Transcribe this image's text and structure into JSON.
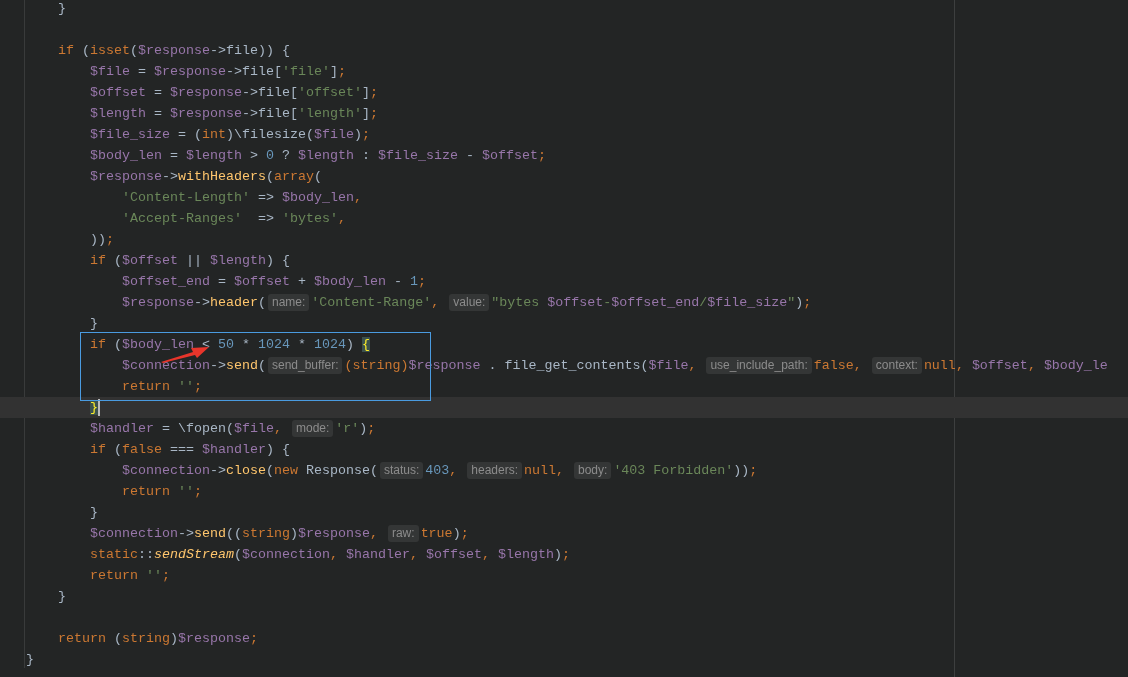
{
  "editor": {
    "lines": [
      {
        "current": false,
        "tokens": [
          {
            "text": "    }",
            "kind": "plain"
          }
        ]
      },
      {
        "current": false
      },
      {
        "current": false,
        "tokens": [
          {
            "text": "    if",
            "kind": "keyword"
          },
          {
            "text": " (",
            "kind": "plain"
          },
          {
            "text": "isset",
            "kind": "keyword"
          },
          {
            "text": "(",
            "kind": "plain"
          },
          {
            "text": "$response",
            "kind": "var"
          },
          {
            "text": "->file)) {",
            "kind": "plain"
          }
        ]
      },
      {
        "current": false,
        "tokens": [
          {
            "text": "        $file",
            "kind": "var"
          },
          {
            "text": " = ",
            "kind": "plain"
          },
          {
            "text": "$response",
            "kind": "var"
          },
          {
            "text": "->file[",
            "kind": "plain"
          },
          {
            "text": "'file'",
            "kind": "string"
          },
          {
            "text": "]",
            "kind": "plain"
          },
          {
            "text": ";",
            "kind": "keyword"
          }
        ]
      },
      {
        "current": false,
        "tokens": [
          {
            "text": "        $offset",
            "kind": "var"
          },
          {
            "text": " = ",
            "kind": "plain"
          },
          {
            "text": "$response",
            "kind": "var"
          },
          {
            "text": "->file[",
            "kind": "plain"
          },
          {
            "text": "'offset'",
            "kind": "string"
          },
          {
            "text": "]",
            "kind": "plain"
          },
          {
            "text": ";",
            "kind": "keyword"
          }
        ]
      },
      {
        "current": false,
        "tokens": [
          {
            "text": "        $length",
            "kind": "var"
          },
          {
            "text": " = ",
            "kind": "plain"
          },
          {
            "text": "$response",
            "kind": "var"
          },
          {
            "text": "->file[",
            "kind": "plain"
          },
          {
            "text": "'length'",
            "kind": "string"
          },
          {
            "text": "]",
            "kind": "plain"
          },
          {
            "text": ";",
            "kind": "keyword"
          }
        ]
      },
      {
        "current": false,
        "tokens": [
          {
            "text": "        $file_size",
            "kind": "var"
          },
          {
            "text": " = (",
            "kind": "plain"
          },
          {
            "text": "int",
            "kind": "keyword"
          },
          {
            "text": ")\\filesize(",
            "kind": "plain"
          },
          {
            "text": "$file",
            "kind": "var"
          },
          {
            "text": ")",
            "kind": "plain"
          },
          {
            "text": ";",
            "kind": "keyword"
          }
        ]
      },
      {
        "current": false,
        "tokens": [
          {
            "text": "        $body_len",
            "kind": "var"
          },
          {
            "text": " = ",
            "kind": "plain"
          },
          {
            "text": "$length",
            "kind": "var"
          },
          {
            "text": " > ",
            "kind": "plain"
          },
          {
            "text": "0",
            "kind": "number"
          },
          {
            "text": " ? ",
            "kind": "plain"
          },
          {
            "text": "$length",
            "kind": "var"
          },
          {
            "text": " : ",
            "kind": "plain"
          },
          {
            "text": "$file_size",
            "kind": "var"
          },
          {
            "text": " - ",
            "kind": "plain"
          },
          {
            "text": "$offset",
            "kind": "var"
          },
          {
            "text": ";",
            "kind": "keyword"
          }
        ]
      },
      {
        "current": false,
        "tokens": [
          {
            "text": "        $response",
            "kind": "var"
          },
          {
            "text": "->",
            "kind": "plain"
          },
          {
            "text": "withHeaders",
            "kind": "function"
          },
          {
            "text": "(",
            "kind": "plain"
          },
          {
            "text": "array",
            "kind": "keyword"
          },
          {
            "text": "(",
            "kind": "plain"
          }
        ]
      },
      {
        "current": false,
        "tokens": [
          {
            "text": "            'Content-Length'",
            "kind": "string"
          },
          {
            "text": " => ",
            "kind": "plain"
          },
          {
            "text": "$body_len",
            "kind": "var"
          },
          {
            "text": ",",
            "kind": "keyword"
          }
        ]
      },
      {
        "current": false,
        "tokens": [
          {
            "text": "            'Accept-Ranges'",
            "kind": "string"
          },
          {
            "text": "  => ",
            "kind": "plain"
          },
          {
            "text": "'bytes'",
            "kind": "string"
          },
          {
            "text": ",",
            "kind": "keyword"
          }
        ]
      },
      {
        "current": false,
        "tokens": [
          {
            "text": "        ))",
            "kind": "plain"
          },
          {
            "text": ";",
            "kind": "keyword"
          }
        ]
      },
      {
        "current": false,
        "tokens": [
          {
            "text": "        if",
            "kind": "keyword"
          },
          {
            "text": " (",
            "kind": "plain"
          },
          {
            "text": "$offset",
            "kind": "var"
          },
          {
            "text": " || ",
            "kind": "plain"
          },
          {
            "text": "$length",
            "kind": "var"
          },
          {
            "text": ") {",
            "kind": "plain"
          }
        ]
      },
      {
        "current": false,
        "tokens": [
          {
            "text": "            $offset_end",
            "kind": "var"
          },
          {
            "text": " = ",
            "kind": "plain"
          },
          {
            "text": "$offset",
            "kind": "var"
          },
          {
            "text": " + ",
            "kind": "plain"
          },
          {
            "text": "$body_len",
            "kind": "var"
          },
          {
            "text": " - ",
            "kind": "plain"
          },
          {
            "text": "1",
            "kind": "number"
          },
          {
            "text": ";",
            "kind": "keyword"
          }
        ]
      },
      {
        "current": false,
        "tokens": [
          {
            "text": "            $response",
            "kind": "var"
          },
          {
            "text": "->",
            "kind": "plain"
          },
          {
            "text": "header",
            "kind": "function"
          },
          {
            "text": "(",
            "kind": "plain"
          },
          {
            "text": "name:",
            "kind": "hint"
          },
          {
            "text": "'Content-Range'",
            "kind": "string"
          },
          {
            "text": ", ",
            "kind": "keyword"
          },
          {
            "text": "value:",
            "kind": "hint"
          },
          {
            "text": "\"bytes ",
            "kind": "string"
          },
          {
            "text": "$offset",
            "kind": "var"
          },
          {
            "text": "-",
            "kind": "string"
          },
          {
            "text": "$offset_end",
            "kind": "var"
          },
          {
            "text": "/",
            "kind": "string"
          },
          {
            "text": "$file_size",
            "kind": "var"
          },
          {
            "text": "\"",
            "kind": "string"
          },
          {
            "text": ")",
            "kind": "plain"
          },
          {
            "text": ";",
            "kind": "keyword"
          }
        ]
      },
      {
        "current": false,
        "tokens": [
          {
            "text": "        }",
            "kind": "plain"
          }
        ]
      },
      {
        "current": false,
        "tokens": [
          {
            "text": "        if",
            "kind": "keyword"
          },
          {
            "text": " (",
            "kind": "plain"
          },
          {
            "text": "$body_len",
            "kind": "var"
          },
          {
            "text": " < ",
            "kind": "plain"
          },
          {
            "text": "50",
            "kind": "number"
          },
          {
            "text": " * ",
            "kind": "plain"
          },
          {
            "text": "1024",
            "kind": "number"
          },
          {
            "text": " * ",
            "kind": "plain"
          },
          {
            "text": "1024",
            "kind": "number"
          },
          {
            "text": ") ",
            "kind": "plain"
          },
          {
            "text": "{",
            "kind": "brace"
          }
        ]
      },
      {
        "current": false,
        "tokens": [
          {
            "text": "            $connection",
            "kind": "var"
          },
          {
            "text": "->",
            "kind": "plain"
          },
          {
            "text": "send",
            "kind": "function"
          },
          {
            "text": "(",
            "kind": "plain"
          },
          {
            "text": "send_buffer:",
            "kind": "hint"
          },
          {
            "text": "(string)",
            "kind": "keyword"
          },
          {
            "text": "$response",
            "kind": "var"
          },
          {
            "text": " . file_get_contents(",
            "kind": "plain"
          },
          {
            "text": "$file",
            "kind": "var"
          },
          {
            "text": ", ",
            "kind": "keyword"
          },
          {
            "text": "use_include_path:",
            "kind": "hint"
          },
          {
            "text": "false",
            "kind": "keyword"
          },
          {
            "text": ", ",
            "kind": "keyword"
          },
          {
            "text": "context:",
            "kind": "hint"
          },
          {
            "text": "null",
            "kind": "keyword"
          },
          {
            "text": ", ",
            "kind": "keyword"
          },
          {
            "text": "$offset",
            "kind": "var"
          },
          {
            "text": ", ",
            "kind": "keyword"
          },
          {
            "text": "$body_le",
            "kind": "var"
          }
        ]
      },
      {
        "current": false,
        "tokens": [
          {
            "text": "            return ",
            "kind": "keyword"
          },
          {
            "text": "''",
            "kind": "string"
          },
          {
            "text": ";",
            "kind": "keyword"
          }
        ]
      },
      {
        "current": true,
        "tokens": [
          {
            "text": "        }",
            "kind": "brace"
          }
        ]
      },
      {
        "current": false,
        "tokens": [
          {
            "text": "        $handler",
            "kind": "var"
          },
          {
            "text": " = \\fopen(",
            "kind": "plain"
          },
          {
            "text": "$file",
            "kind": "var"
          },
          {
            "text": ", ",
            "kind": "keyword"
          },
          {
            "text": "mode:",
            "kind": "hint"
          },
          {
            "text": "'r'",
            "kind": "string"
          },
          {
            "text": ")",
            "kind": "plain"
          },
          {
            "text": ";",
            "kind": "keyword"
          }
        ]
      },
      {
        "current": false,
        "tokens": [
          {
            "text": "        if",
            "kind": "keyword"
          },
          {
            "text": " (",
            "kind": "plain"
          },
          {
            "text": "false",
            "kind": "keyword"
          },
          {
            "text": " === ",
            "kind": "plain"
          },
          {
            "text": "$handler",
            "kind": "var"
          },
          {
            "text": ") {",
            "kind": "plain"
          }
        ]
      },
      {
        "current": false,
        "tokens": [
          {
            "text": "            $connection",
            "kind": "var"
          },
          {
            "text": "->",
            "kind": "plain"
          },
          {
            "text": "close",
            "kind": "function"
          },
          {
            "text": "(",
            "kind": "plain"
          },
          {
            "text": "new",
            "kind": "keyword"
          },
          {
            "text": " Response(",
            "kind": "plain"
          },
          {
            "text": "status:",
            "kind": "hint"
          },
          {
            "text": "403",
            "kind": "number"
          },
          {
            "text": ", ",
            "kind": "keyword"
          },
          {
            "text": "headers:",
            "kind": "hint"
          },
          {
            "text": "null",
            "kind": "keyword"
          },
          {
            "text": ", ",
            "kind": "keyword"
          },
          {
            "text": "body:",
            "kind": "hint"
          },
          {
            "text": "'403 Forbidden'",
            "kind": "string"
          },
          {
            "text": "))",
            "kind": "plain"
          },
          {
            "text": ";",
            "kind": "keyword"
          }
        ]
      },
      {
        "current": false,
        "tokens": [
          {
            "text": "            return ",
            "kind": "keyword"
          },
          {
            "text": "''",
            "kind": "string"
          },
          {
            "text": ";",
            "kind": "keyword"
          }
        ]
      },
      {
        "current": false,
        "tokens": [
          {
            "text": "        }",
            "kind": "plain"
          }
        ]
      },
      {
        "current": false,
        "tokens": [
          {
            "text": "        $connection",
            "kind": "var"
          },
          {
            "text": "->",
            "kind": "plain"
          },
          {
            "text": "send",
            "kind": "function"
          },
          {
            "text": "((",
            "kind": "plain"
          },
          {
            "text": "string",
            "kind": "keyword"
          },
          {
            "text": ")",
            "kind": "plain"
          },
          {
            "text": "$response",
            "kind": "var"
          },
          {
            "text": ", ",
            "kind": "keyword"
          },
          {
            "text": "raw:",
            "kind": "hint"
          },
          {
            "text": "true",
            "kind": "keyword"
          },
          {
            "text": ")",
            "kind": "plain"
          },
          {
            "text": ";",
            "kind": "keyword"
          }
        ]
      },
      {
        "current": false,
        "tokens": [
          {
            "text": "        static",
            "kind": "keyword"
          },
          {
            "text": "::",
            "kind": "plain"
          },
          {
            "text": "sendStream",
            "kind": "static_call"
          },
          {
            "text": "(",
            "kind": "plain"
          },
          {
            "text": "$connection",
            "kind": "var"
          },
          {
            "text": ", ",
            "kind": "keyword"
          },
          {
            "text": "$handler",
            "kind": "var"
          },
          {
            "text": ", ",
            "kind": "keyword"
          },
          {
            "text": "$offset",
            "kind": "var"
          },
          {
            "text": ", ",
            "kind": "keyword"
          },
          {
            "text": "$length",
            "kind": "var"
          },
          {
            "text": ")",
            "kind": "plain"
          },
          {
            "text": ";",
            "kind": "keyword"
          }
        ]
      },
      {
        "current": false,
        "tokens": [
          {
            "text": "        return ",
            "kind": "keyword"
          },
          {
            "text": "''",
            "kind": "string"
          },
          {
            "text": ";",
            "kind": "keyword"
          }
        ]
      },
      {
        "current": false,
        "tokens": [
          {
            "text": "    }",
            "kind": "plain"
          }
        ]
      },
      {
        "current": false
      },
      {
        "current": false,
        "tokens": [
          {
            "text": "    return",
            "kind": "keyword"
          },
          {
            "text": " (",
            "kind": "plain"
          },
          {
            "text": "string",
            "kind": "keyword"
          },
          {
            "text": ")",
            "kind": "plain"
          },
          {
            "text": "$response",
            "kind": "var"
          },
          {
            "text": ";",
            "kind": "keyword"
          }
        ]
      },
      {
        "current": false,
        "tokens": [
          {
            "text": "}",
            "kind": "plain"
          }
        ]
      }
    ]
  },
  "annotations": {
    "highlight_box": true,
    "arrow": true
  }
}
